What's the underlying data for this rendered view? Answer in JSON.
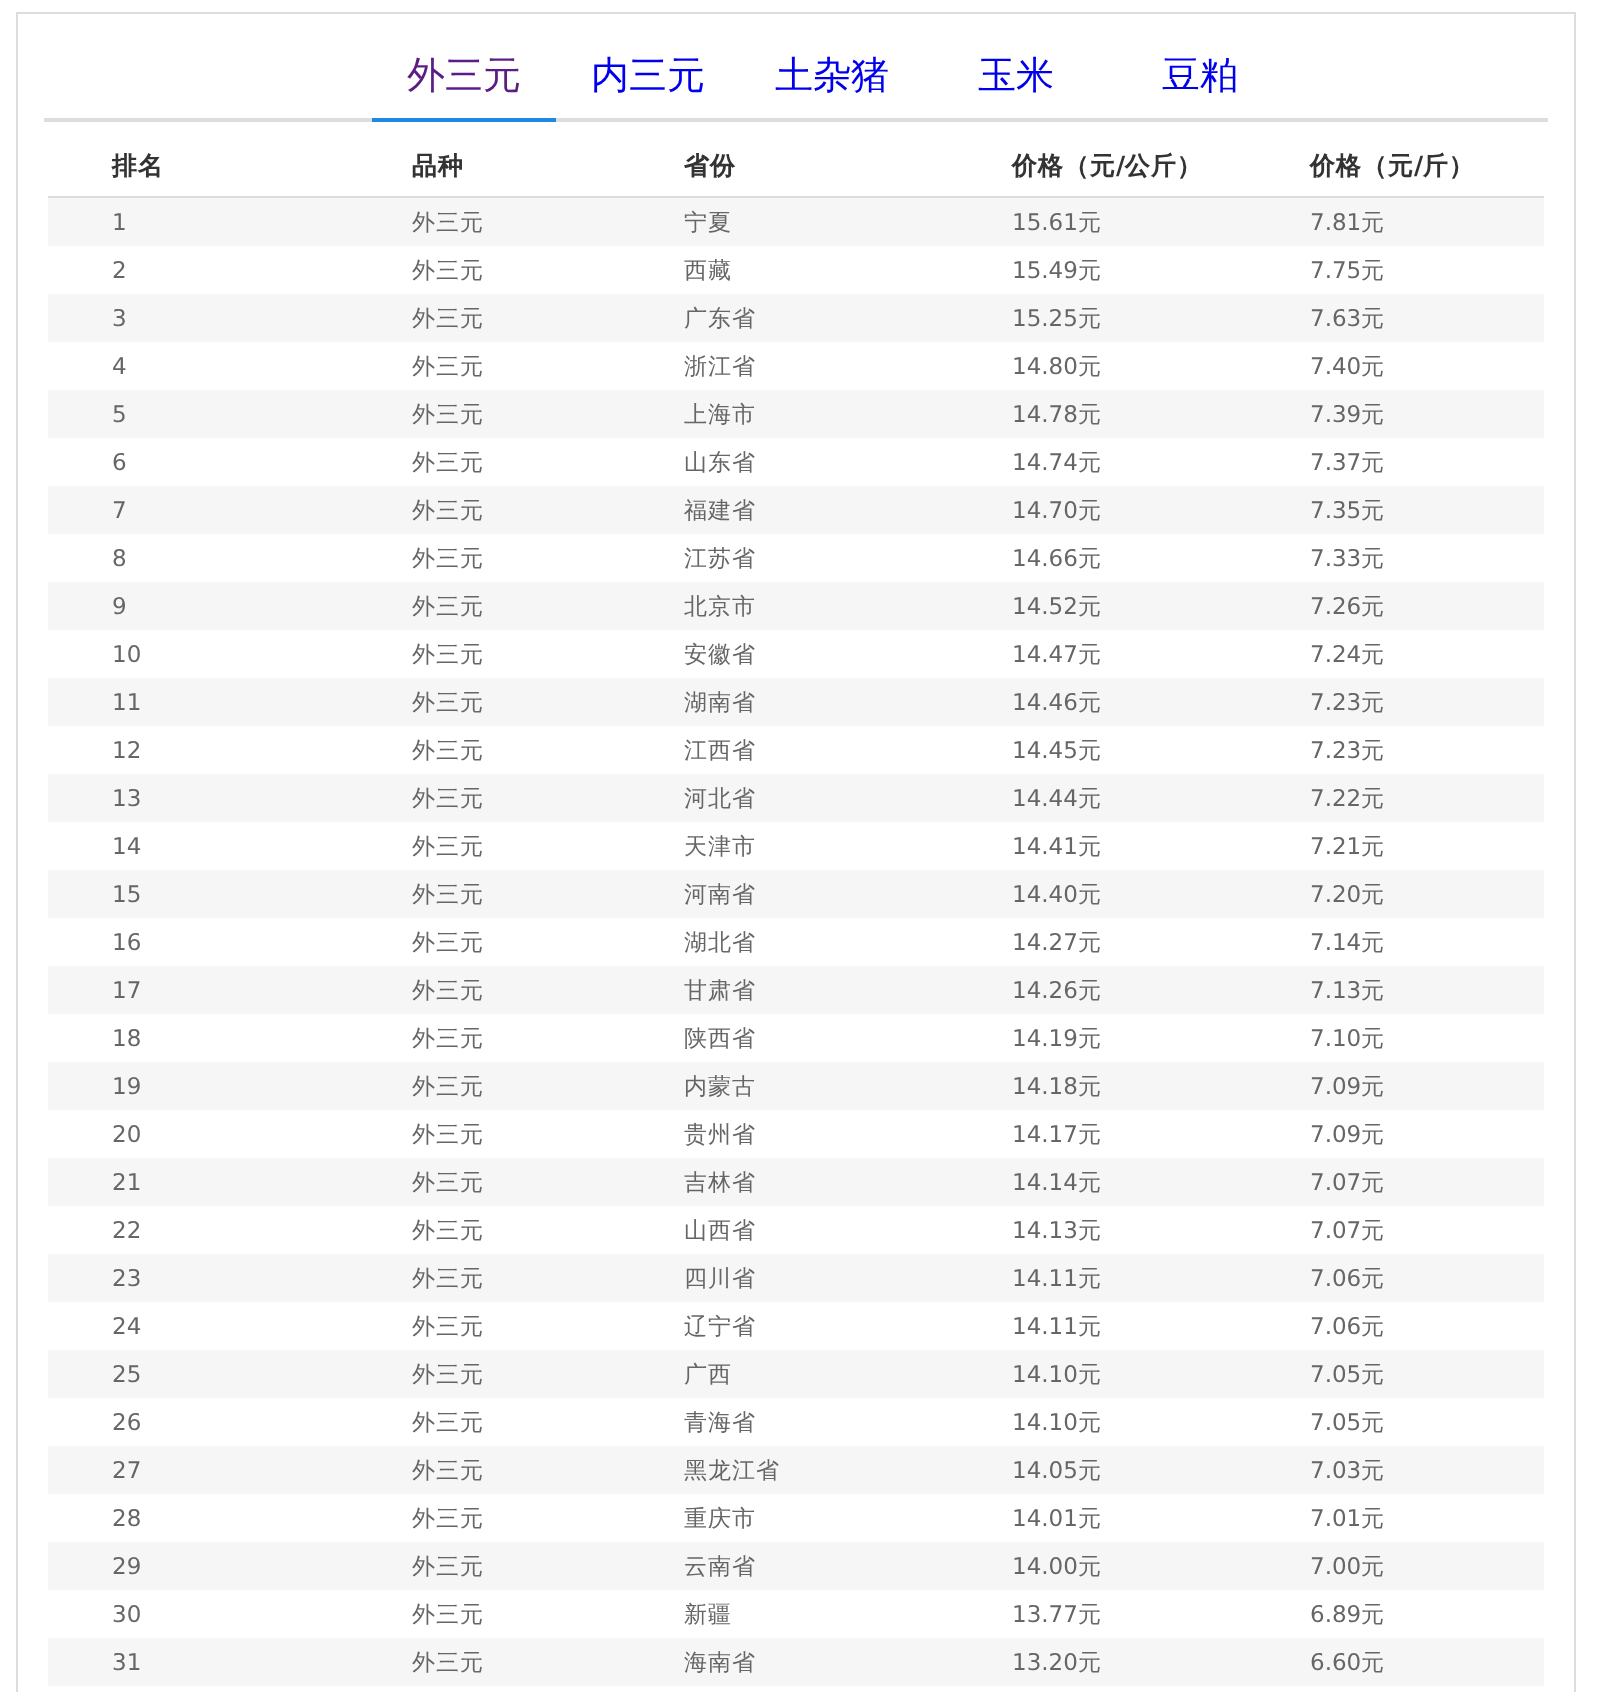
{
  "tabs": [
    {
      "label": "外三元",
      "selected": true
    },
    {
      "label": "内三元",
      "selected": false
    },
    {
      "label": "土杂猪",
      "selected": false
    },
    {
      "label": "玉米",
      "selected": false
    },
    {
      "label": "豆粕",
      "selected": false
    }
  ],
  "table": {
    "columns": [
      "排名",
      "品种",
      "省份",
      "价格（元/公斤）",
      "价格（元/斤）"
    ],
    "rows": [
      [
        "1",
        "外三元",
        "宁夏",
        "15.61元",
        "7.81元"
      ],
      [
        "2",
        "外三元",
        "西藏",
        "15.49元",
        "7.75元"
      ],
      [
        "3",
        "外三元",
        "广东省",
        "15.25元",
        "7.63元"
      ],
      [
        "4",
        "外三元",
        "浙江省",
        "14.80元",
        "7.40元"
      ],
      [
        "5",
        "外三元",
        "上海市",
        "14.78元",
        "7.39元"
      ],
      [
        "6",
        "外三元",
        "山东省",
        "14.74元",
        "7.37元"
      ],
      [
        "7",
        "外三元",
        "福建省",
        "14.70元",
        "7.35元"
      ],
      [
        "8",
        "外三元",
        "江苏省",
        "14.66元",
        "7.33元"
      ],
      [
        "9",
        "外三元",
        "北京市",
        "14.52元",
        "7.26元"
      ],
      [
        "10",
        "外三元",
        "安徽省",
        "14.47元",
        "7.24元"
      ],
      [
        "11",
        "外三元",
        "湖南省",
        "14.46元",
        "7.23元"
      ],
      [
        "12",
        "外三元",
        "江西省",
        "14.45元",
        "7.23元"
      ],
      [
        "13",
        "外三元",
        "河北省",
        "14.44元",
        "7.22元"
      ],
      [
        "14",
        "外三元",
        "天津市",
        "14.41元",
        "7.21元"
      ],
      [
        "15",
        "外三元",
        "河南省",
        "14.40元",
        "7.20元"
      ],
      [
        "16",
        "外三元",
        "湖北省",
        "14.27元",
        "7.14元"
      ],
      [
        "17",
        "外三元",
        "甘肃省",
        "14.26元",
        "7.13元"
      ],
      [
        "18",
        "外三元",
        "陕西省",
        "14.19元",
        "7.10元"
      ],
      [
        "19",
        "外三元",
        "内蒙古",
        "14.18元",
        "7.09元"
      ],
      [
        "20",
        "外三元",
        "贵州省",
        "14.17元",
        "7.09元"
      ],
      [
        "21",
        "外三元",
        "吉林省",
        "14.14元",
        "7.07元"
      ],
      [
        "22",
        "外三元",
        "山西省",
        "14.13元",
        "7.07元"
      ],
      [
        "23",
        "外三元",
        "四川省",
        "14.11元",
        "7.06元"
      ],
      [
        "24",
        "外三元",
        "辽宁省",
        "14.11元",
        "7.06元"
      ],
      [
        "25",
        "外三元",
        "广西",
        "14.10元",
        "7.05元"
      ],
      [
        "26",
        "外三元",
        "青海省",
        "14.10元",
        "7.05元"
      ],
      [
        "27",
        "外三元",
        "黑龙江省",
        "14.05元",
        "7.03元"
      ],
      [
        "28",
        "外三元",
        "重庆市",
        "14.01元",
        "7.01元"
      ],
      [
        "29",
        "外三元",
        "云南省",
        "14.00元",
        "7.00元"
      ],
      [
        "30",
        "外三元",
        "新疆",
        "13.77元",
        "6.89元"
      ],
      [
        "31",
        "外三元",
        "海南省",
        "13.20元",
        "6.60元"
      ]
    ]
  }
}
